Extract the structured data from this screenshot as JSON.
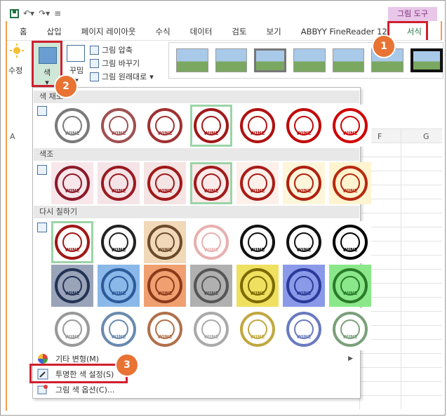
{
  "title_bar": {
    "tool_group": "그림 도구"
  },
  "tabs": [
    "홈",
    "삽입",
    "페이지 레이아웃",
    "수식",
    "데이터",
    "검토",
    "보기",
    "ABBYY FineReader 12",
    "서식"
  ],
  "ribbon": {
    "adjust_label": "수정",
    "color_label": "색",
    "artistic_label": "꾸밈",
    "compress": "그림 압축",
    "change": "그림 바꾸기",
    "reset": "그림 원래대로"
  },
  "columns": {
    "a": "A",
    "f": "F",
    "g": "G"
  },
  "dropdown": {
    "sections": [
      {
        "title": "색 채도",
        "colors": [
          "#7a7a7a",
          "#a05050",
          "#a03030",
          "#a01818",
          "#b01010",
          "#c00808",
          "#d00000"
        ],
        "selected": 3
      },
      {
        "title": "색조",
        "colors": [
          "#8b1a2a",
          "#9a1a20",
          "#a01818",
          "#a01a1a",
          "#a81c16",
          "#b02010",
          "#b82a10"
        ],
        "selected": 3
      },
      {
        "title": "다시 칠하기",
        "selected": 0
      }
    ],
    "recolor_rows": [
      [
        "#a01818",
        "#222222",
        "#6b4a2a",
        "#e8b0b0",
        "#111111",
        "#111111",
        "#000000"
      ],
      [
        "#223355",
        "#2a5a9a",
        "#8a3a1a",
        "#555555",
        "#7a6a00",
        "#2a3a9a",
        "#2a7a2a"
      ],
      [
        "#999999",
        "#6a8ab0",
        "#b0704a",
        "#aaaaaa",
        "#c0a840",
        "#6a7ac0",
        "#7aa07a"
      ]
    ],
    "recolor_backgrounds": [
      [
        "#ffffff",
        "#ffffff",
        "#f0d8b8",
        "#ffffff",
        "#ffffff",
        "#ffffff",
        "#ffffff"
      ],
      [
        "#9aa4b8",
        "#8ab8e8",
        "#f0a070",
        "#b0b0b0",
        "#f0e060",
        "#8a9ae8",
        "#8ae88a"
      ],
      [
        "#ffffff",
        "#ffffff",
        "#ffffff",
        "#ffffff",
        "#ffffff",
        "#ffffff",
        "#ffffff"
      ]
    ],
    "menu": [
      {
        "label": "기타 변형(M)",
        "icon": "color-wheel-icon",
        "submenu": true
      },
      {
        "label": "투명한 색 설정(S)",
        "icon": "eyedropper-icon",
        "submenu": false
      },
      {
        "label": "그림 색 옵션(C)...",
        "icon": "picture-color-options-icon",
        "submenu": false
      }
    ]
  },
  "badges": [
    "1",
    "2",
    "3"
  ],
  "stamp_text": "WINE",
  "colors": {
    "callout": "#d01f2f",
    "badge": "#e87333",
    "selected": "#9bd4a8",
    "tools_tab_bg": "#e9c7e9"
  }
}
